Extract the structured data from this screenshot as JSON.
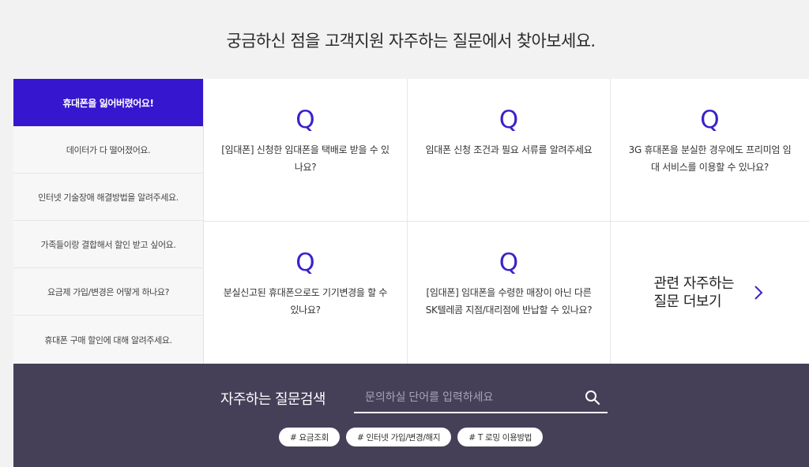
{
  "header": {
    "title": "궁금하신 점을 고객지원 자주하는 질문에서 찾아보세요."
  },
  "sidebar": {
    "items": [
      {
        "label": "휴대폰을 잃어버렸어요!",
        "active": true
      },
      {
        "label": "데이터가 다 떨어졌어요."
      },
      {
        "label": "인터넷 기술장애 해결방법을 알려주세요."
      },
      {
        "label": "가족들이랑 결합해서 할인 받고 싶어요."
      },
      {
        "label": "요금제 가입/변경은 어떻게 하나요?"
      },
      {
        "label": "휴대폰 구매 할인에 대해 알려주세요."
      }
    ]
  },
  "faq": {
    "q_mark": "Q",
    "cards": [
      {
        "text": "[임대폰] 신청한 임대폰을 택배로 받을 수 있나요?"
      },
      {
        "text": "임대폰 신청 조건과 필요 서류를 알려주세요"
      },
      {
        "text": "3G 휴대폰을 분실한 경우에도 프리미엄 임대 서비스를 이용할 수 있나요?"
      },
      {
        "text": "분실신고된 휴대폰으로도 기기변경을 할 수 있나요?"
      },
      {
        "text": "[임대폰] 임대폰을 수령한 매장이 아닌 다른 SK텔레콤 지점/대리점에 반납할 수 있나요?"
      }
    ],
    "more_label": "관련 자주하는 질문 더보기"
  },
  "search": {
    "title": "자주하는 질문검색",
    "placeholder": "문의하실 단어를 입력하세요",
    "value": "",
    "tags": [
      "# 요금조회",
      "# 인터넷 가입/변경/해지",
      "# T 로밍 이용방법"
    ]
  },
  "colors": {
    "accent": "#3617cf",
    "q_color": "#3a22cc",
    "search_band": "#453f58"
  }
}
